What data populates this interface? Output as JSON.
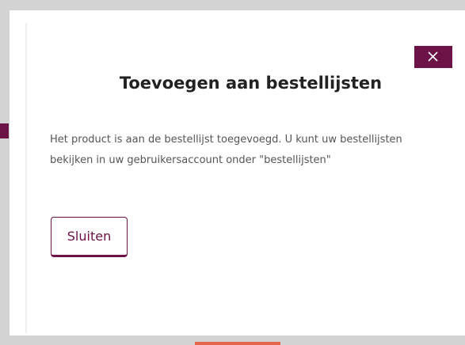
{
  "dialog": {
    "title": "Toevoegen aan bestellijsten",
    "message": "Het product is aan de bestellijst toegevoegd. U kunt uw bestellijsten bekijken in uw gebruikersaccount onder \"bestellijsten\"",
    "close_button_label": "Sluiten",
    "close_icon": "close-icon"
  },
  "colors": {
    "accent": "#6b1247",
    "page_accent_orange": "#e2674b",
    "backdrop": "#d3d3d3"
  }
}
